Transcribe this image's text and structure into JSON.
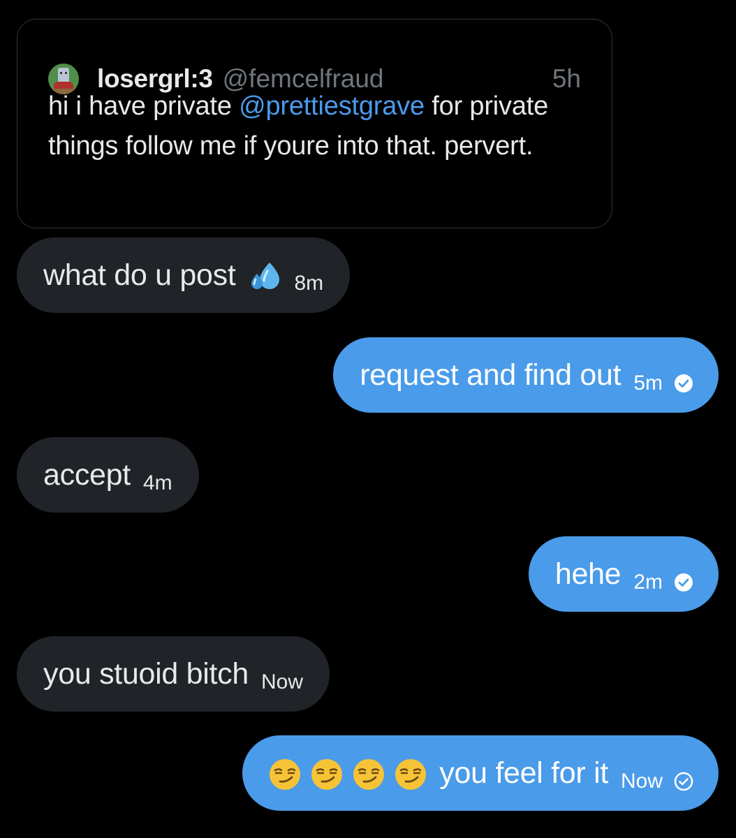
{
  "quoted_tweet": {
    "display_name": "losergrl:3",
    "handle": "@femcelfraud",
    "timestamp": "5h",
    "avatar_icon": "avatar-image",
    "body_before": "hi i have private ",
    "mention": "@prettiestgrave",
    "body_after": " for private things follow me if youre into that. pervert."
  },
  "messages": [
    {
      "direction": "received",
      "text": "what do u post",
      "emoji": "sweat-droplets-emoji",
      "time": "8m"
    },
    {
      "direction": "sent",
      "text": "request and find out",
      "time": "5m",
      "status_icon": "check-circle-filled-icon"
    },
    {
      "direction": "received",
      "text": "accept",
      "time": "4m"
    },
    {
      "direction": "sent",
      "text": "hehe",
      "time": "2m",
      "status_icon": "check-circle-filled-icon"
    },
    {
      "direction": "received",
      "text": "you stuoid bitch",
      "time": "Now"
    },
    {
      "direction": "sent",
      "emoji_prefix": [
        "smirking-face-emoji",
        "smirking-face-emoji",
        "smirking-face-emoji",
        "smirking-face-emoji"
      ],
      "text": "you feel for it",
      "time": "Now",
      "status_icon": "check-circle-outline-icon"
    }
  ],
  "colors": {
    "background": "#000000",
    "received_bubble": "#202327",
    "sent_bubble": "#4a9be9",
    "mention": "#4a9bec",
    "muted_text": "#71767b"
  }
}
